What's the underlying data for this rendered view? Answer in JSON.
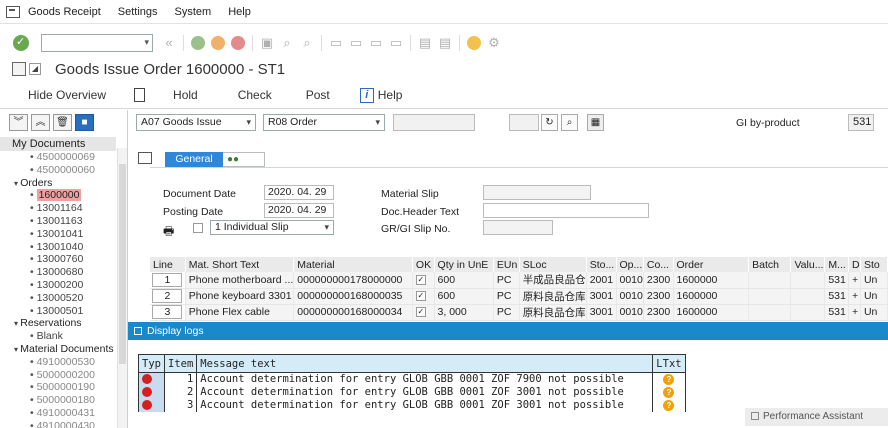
{
  "menubar": {
    "items": [
      {
        "label": "Goods Receipt",
        "underline": "G"
      },
      {
        "label": "Settings",
        "underline": "S"
      },
      {
        "label": "System",
        "underline": "y"
      },
      {
        "label": "Help",
        "underline": "H"
      }
    ]
  },
  "toolbar": {
    "command_value": ""
  },
  "title": {
    "text": "Goods Issue Order 1600000 - ST1"
  },
  "apptoolbar": {
    "hide_overview": "Hide Overview",
    "hold": "Hold",
    "check": "Check",
    "post": "Post",
    "help": "Help"
  },
  "header": {
    "transaction": "A07 Goods Issue",
    "reference": "R08 Order",
    "gi_label": "GI by-product",
    "gi_value": "531"
  },
  "tree": {
    "root": "My Documents",
    "rows": [
      {
        "level": 2,
        "text": "4500000069",
        "grey": true
      },
      {
        "level": 2,
        "text": "4500000060",
        "grey": true
      },
      {
        "level": 1,
        "text": "Orders"
      },
      {
        "level": 2,
        "text": "1600000",
        "selected": true
      },
      {
        "level": 2,
        "text": "13001164"
      },
      {
        "level": 2,
        "text": "13001163"
      },
      {
        "level": 2,
        "text": "13001041"
      },
      {
        "level": 2,
        "text": "13001040"
      },
      {
        "level": 2,
        "text": "13000760"
      },
      {
        "level": 2,
        "text": "13000680"
      },
      {
        "level": 2,
        "text": "13000200"
      },
      {
        "level": 2,
        "text": "13000520"
      },
      {
        "level": 2,
        "text": "13000501"
      },
      {
        "level": 1,
        "text": "Reservations"
      },
      {
        "level": 2,
        "text": "Blank"
      },
      {
        "level": 1,
        "text": "Material Documents"
      },
      {
        "level": 2,
        "text": "4910000530",
        "grey": true
      },
      {
        "level": 2,
        "text": "5000000200",
        "grey": true
      },
      {
        "level": 2,
        "text": "5000000190",
        "grey": true
      },
      {
        "level": 2,
        "text": "5000000180",
        "grey": true
      },
      {
        "level": 2,
        "text": "4910000431",
        "grey": true
      },
      {
        "level": 2,
        "text": "4910000430",
        "grey": true
      }
    ]
  },
  "tabs": {
    "general": "General"
  },
  "form": {
    "document_date_label": "Document Date",
    "document_date": "2020. 04. 29",
    "posting_date_label": "Posting Date",
    "posting_date": "2020. 04. 29",
    "slip_option": "1 Individual Slip",
    "material_slip_label": "Material Slip",
    "doc_header_text_label": "Doc.Header Text",
    "gr_gi_slip_label": "GR/GI Slip No."
  },
  "items": {
    "columns": [
      "Line",
      "Mat. Short Text",
      "Material",
      "OK",
      "Qty in UnE",
      "EUn",
      "SLoc",
      "Sto...",
      "Op...",
      "Co...",
      "Order",
      "Batch",
      "Valu...",
      "M...",
      "D",
      "Sto"
    ],
    "rows": [
      [
        "1",
        "Phone motherboard ...",
        "000000000178000000",
        "✓",
        "600",
        "PC",
        "半成品良品仓",
        "2001",
        "0010",
        "2300",
        "1600000",
        "",
        "",
        "531",
        "+",
        "Un"
      ],
      [
        "2",
        "Phone keyboard 3301",
        "000000000168000035",
        "✓",
        "600",
        "PC",
        "原料良品仓库",
        "3001",
        "0010",
        "2300",
        "1600000",
        "",
        "",
        "531",
        "+",
        "Un"
      ],
      [
        "3",
        "Phone Flex cable",
        "000000000168000034",
        "✓",
        "3, 000",
        "PC",
        "原料良品仓库",
        "3001",
        "0010",
        "2300",
        "1600000",
        "",
        "",
        "531",
        "+",
        "Un"
      ]
    ]
  },
  "log": {
    "title": "Display logs",
    "columns": [
      "Typ",
      "Item",
      "Message text",
      "LTxt"
    ],
    "rows": [
      {
        "item": "1",
        "message": "Account determination for entry GLOB GBB 0001 ZOF 7900 not possible"
      },
      {
        "item": "2",
        "message": "Account determination for entry GLOB GBB 0001 ZOF 3001 not possible"
      },
      {
        "item": "3",
        "message": "Account determination for entry GLOB GBB 0001 ZOF 3001 not possible"
      }
    ]
  },
  "performance_assistant": "Performance Assistant",
  "colors": {
    "accent_blue": "#1b88c9",
    "tab_blue": "#2e87d8",
    "error_red": "#d42020",
    "warning_orange": "#f2a100",
    "selected_tree": "#f0a0a0"
  }
}
